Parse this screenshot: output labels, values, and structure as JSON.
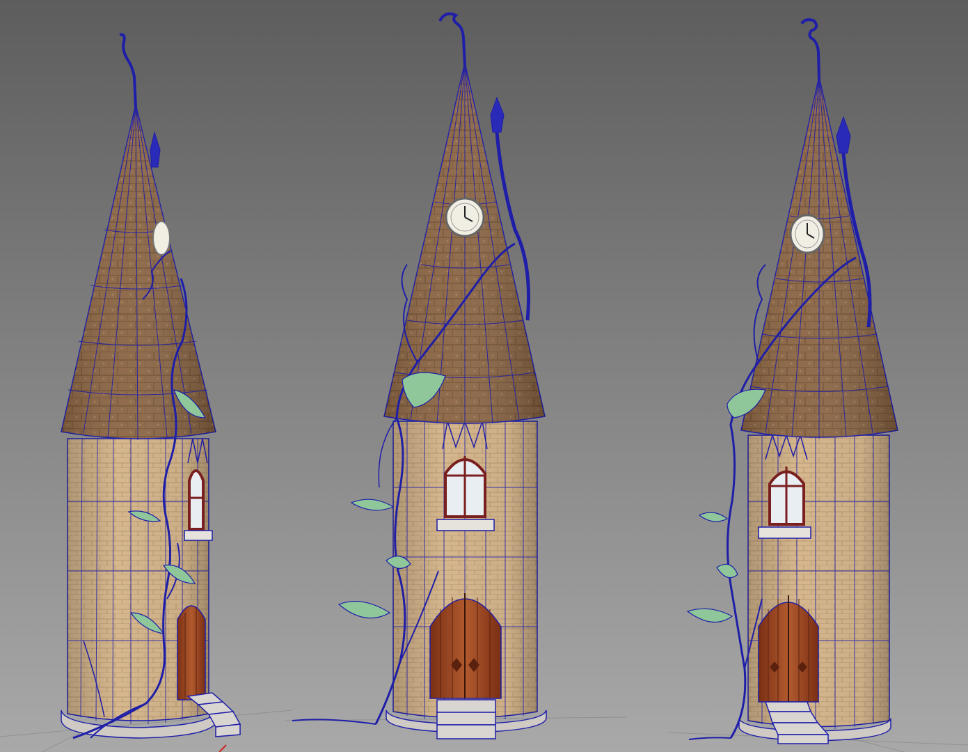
{
  "viewport": {
    "background_top": "#5d5d5d",
    "background_bottom": "#a9a9a9"
  },
  "colors": {
    "wireframe": "#1e1ea8",
    "roof": "#8a6442",
    "roof_dark": "#6b4a2e",
    "wall": "#d6b78e",
    "wall_mortar": "#b89a73",
    "door": "#8a3a1c",
    "door_light": "#b25a2e",
    "window_frame": "#7a1f1f",
    "glass": "#e9eef3",
    "sill": "#e6e2dc",
    "stone": "#d9d6d2",
    "leaf": "#8fc79a",
    "vine": "#1e1ea8",
    "clock_face": "#f1eee4",
    "axis_red": "#cc2222"
  },
  "models": [
    {
      "view": "side",
      "has_clock": true,
      "clock_visible": "partial",
      "window": "side",
      "door": "side",
      "stairs": "side"
    },
    {
      "view": "front",
      "has_clock": true,
      "clock_visible": "full",
      "window": "front",
      "door": "front",
      "stairs": "front"
    },
    {
      "view": "three-quarter",
      "has_clock": true,
      "clock_visible": "full",
      "window": "front",
      "door": "front",
      "stairs": "side"
    }
  ]
}
